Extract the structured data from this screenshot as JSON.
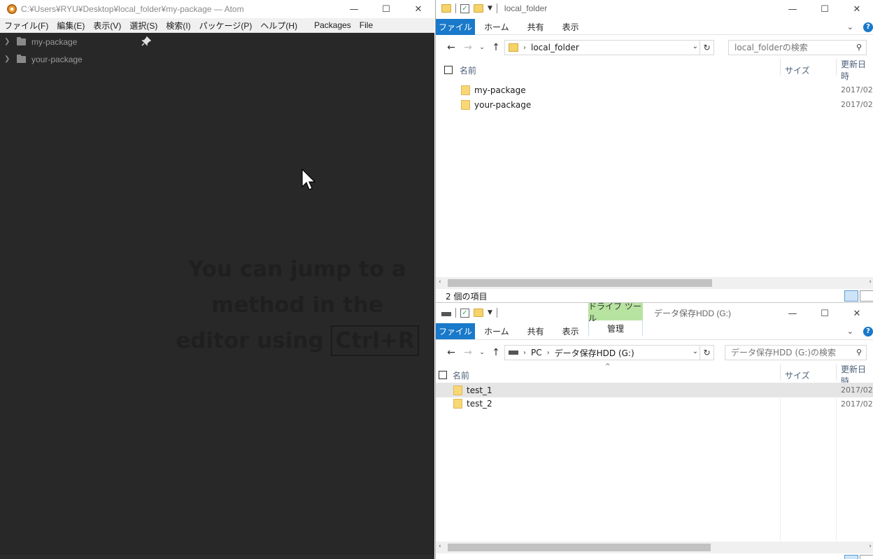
{
  "atom": {
    "title": "C:¥Users¥RYU¥Desktop¥local_folder¥my-package — Atom",
    "window_controls": {
      "minimize": "—",
      "maximize": "☐",
      "close": "✕"
    },
    "menu": [
      "ファイル(F)",
      "編集(E)",
      "表示(V)",
      "選択(S)",
      "検索(I)",
      "パッケージ(P)",
      "ヘルプ(H)",
      "Packages",
      "File"
    ],
    "tree": [
      {
        "label": "my-package"
      },
      {
        "label": "your-package"
      }
    ],
    "tip": {
      "line1": "You can jump to a",
      "line2": "method in the",
      "line3": "editor using",
      "shortcut": "Ctrl+R"
    },
    "icons": {
      "pin": "pin-icon",
      "chevron": "chevron-right-icon",
      "folder": "folder-icon",
      "cursor": "mouse-cursor-icon"
    }
  },
  "explorer_top": {
    "title": "local_folder",
    "ribbon": {
      "file": "ファイル",
      "tabs": [
        "ホーム",
        "共有",
        "表示"
      ]
    },
    "breadcrumb": [
      "local_folder"
    ],
    "search_placeholder": "local_folderの検索",
    "columns": {
      "name": "名前",
      "size": "サイズ",
      "date": "更新日時"
    },
    "items": [
      {
        "name": "my-package",
        "date": "2017/02/"
      },
      {
        "name": "your-package",
        "date": "2017/02/"
      }
    ],
    "status": "2 個の項目"
  },
  "explorer_bottom": {
    "title": "データ保存HDD (G:)",
    "context_tab": {
      "group": "ドライブ ツール",
      "tab": "管理"
    },
    "ribbon": {
      "file": "ファイル",
      "tabs": [
        "ホーム",
        "共有",
        "表示"
      ]
    },
    "breadcrumb": [
      "PC",
      "データ保存HDD (G:)"
    ],
    "search_placeholder": "データ保存HDD (G:)の検索",
    "columns": {
      "name": "名前",
      "size": "サイズ",
      "date": "更新日時"
    },
    "items": [
      {
        "name": "test_1",
        "date": "2017/02/",
        "selected": true
      },
      {
        "name": "test_2",
        "date": "2017/02/",
        "selected": false
      }
    ]
  },
  "colors": {
    "atom_bg": "#282828",
    "ribbon_blue": "#1979ca",
    "drive_tools_green": "#b7e3a0",
    "folder_yellow": "#f8d775"
  }
}
